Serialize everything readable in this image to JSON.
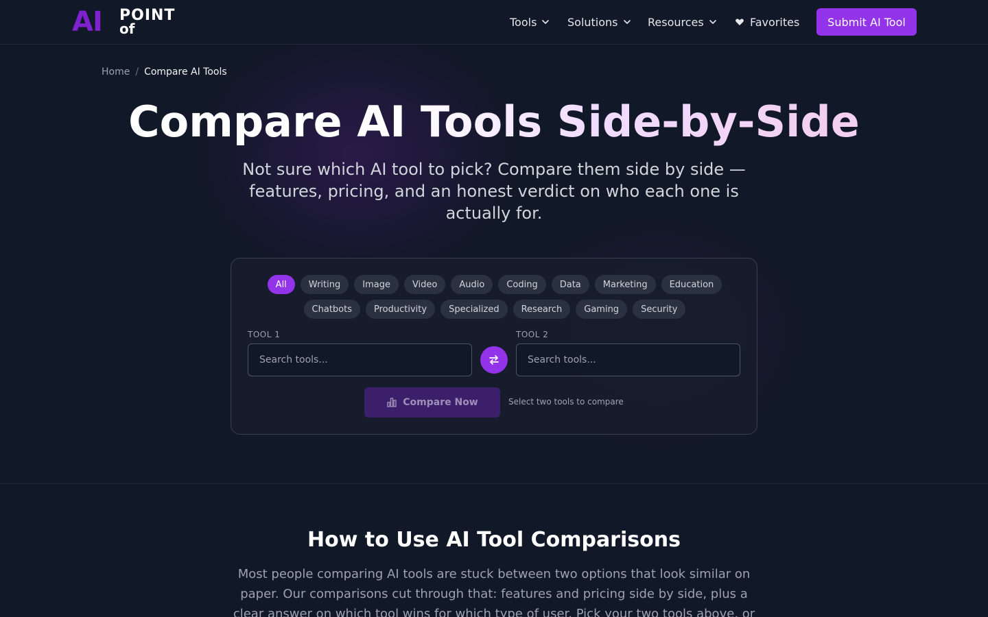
{
  "brand": {
    "logo_ai": "AI",
    "logo_point": "POINT",
    "logo_of": "of"
  },
  "nav": {
    "tools": "Tools",
    "solutions": "Solutions",
    "resources": "Resources",
    "favorites": "Favorites",
    "submit": "Submit AI Tool"
  },
  "breadcrumb": {
    "home": "Home",
    "separator": "/",
    "current": "Compare AI Tools"
  },
  "hero": {
    "title": "Compare AI Tools Side-by-Side",
    "subtitle": "Not sure which AI tool to pick? Compare them side by side — features, pricing, and an honest verdict on who each one is actually for."
  },
  "categories": {
    "row1": [
      "All",
      "Writing",
      "Image",
      "Video",
      "Audio",
      "Coding",
      "Data",
      "Marketing",
      "Education"
    ],
    "row2": [
      "Chatbots",
      "Productivity",
      "Specialized",
      "Research",
      "Gaming",
      "Security"
    ],
    "active": "All"
  },
  "compare": {
    "tool1_label": "TOOL 1",
    "tool2_label": "TOOL 2",
    "tool1_placeholder": "Search tools...",
    "tool2_placeholder": "Search tools...",
    "tool1_value": "",
    "tool2_value": "",
    "button_label": "Compare Now",
    "hint": "Select two tools to compare"
  },
  "how_to": {
    "title": "How to Use AI Tool Comparisons",
    "body": "Most people comparing AI tools are stuck between two options that look similar on paper. Our comparisons cut through that: features and pricing side by side, plus a clear answer on which tool wins for which type of user. Pick your two tools above, or"
  },
  "colors": {
    "background": "#111827",
    "accent": "#9333ea",
    "logo_purple": "#7e22ce",
    "chip_bg": "#2a3140",
    "compare_disabled": "#3b1f6b"
  },
  "icons": {
    "chevron": "chevron-down-icon",
    "favorites": "heart-icon",
    "swap": "swap-arrows-icon",
    "compare": "bar-chart-icon"
  }
}
